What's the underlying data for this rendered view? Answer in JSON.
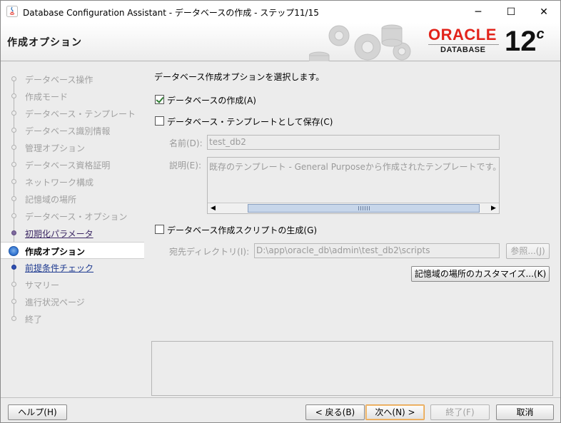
{
  "window": {
    "title": "Database Configuration Assistant - データベースの作成 - ステップ11/15",
    "minimize": "─",
    "maximize": "☐",
    "close": "✕"
  },
  "header": {
    "page_title": "作成オプション",
    "logo_text": "ORACLE",
    "logo_sub": "DATABASE",
    "version": "12",
    "version_suffix": "c"
  },
  "steps": [
    {
      "label": "データベース操作",
      "state": "pending"
    },
    {
      "label": "作成モード",
      "state": "pending"
    },
    {
      "label": "データベース・テンプレート",
      "state": "pending"
    },
    {
      "label": "データベース識別情報",
      "state": "pending"
    },
    {
      "label": "管理オプション",
      "state": "pending"
    },
    {
      "label": "データベース資格証明",
      "state": "pending"
    },
    {
      "label": "ネットワーク構成",
      "state": "pending"
    },
    {
      "label": "記憶域の場所",
      "state": "pending"
    },
    {
      "label": "データベース・オプション",
      "state": "pending"
    },
    {
      "label": "初期化パラメータ",
      "state": "done"
    },
    {
      "label": "作成オプション",
      "state": "current"
    },
    {
      "label": "前提条件チェック",
      "state": "next"
    },
    {
      "label": "サマリー",
      "state": "pending"
    },
    {
      "label": "進行状況ページ",
      "state": "pending"
    },
    {
      "label": "終了",
      "state": "pending"
    }
  ],
  "content": {
    "instruction": "データベース作成オプションを選択します。",
    "create_db": {
      "label": "データベースの作成(A)",
      "checked": true
    },
    "save_template": {
      "label": "データベース・テンプレートとして保存(C)",
      "checked": false
    },
    "name_label": "名前(D):",
    "name_value": "test_db2",
    "desc_label": "説明(E):",
    "desc_value": "既存のテンプレート - General Purposeから作成されたテンプレートです。",
    "scroll_left": "◀",
    "scroll_right": "▶",
    "gen_scripts": {
      "label": "データベース作成スクリプトの生成(G)",
      "checked": false
    },
    "dest_label": "宛先ディレクトリ(I):",
    "dest_value": "D:\\app\\oracle_db\\admin\\test_db2\\scripts",
    "browse_button": "参照...(J)",
    "customize_button": "記憶域の場所のカスタマイズ...(K)"
  },
  "footer": {
    "help": "ヘルプ(H)",
    "back": "< 戻る(B)",
    "next": "次へ(N) >",
    "finish": "終了(F)",
    "cancel": "取消"
  }
}
